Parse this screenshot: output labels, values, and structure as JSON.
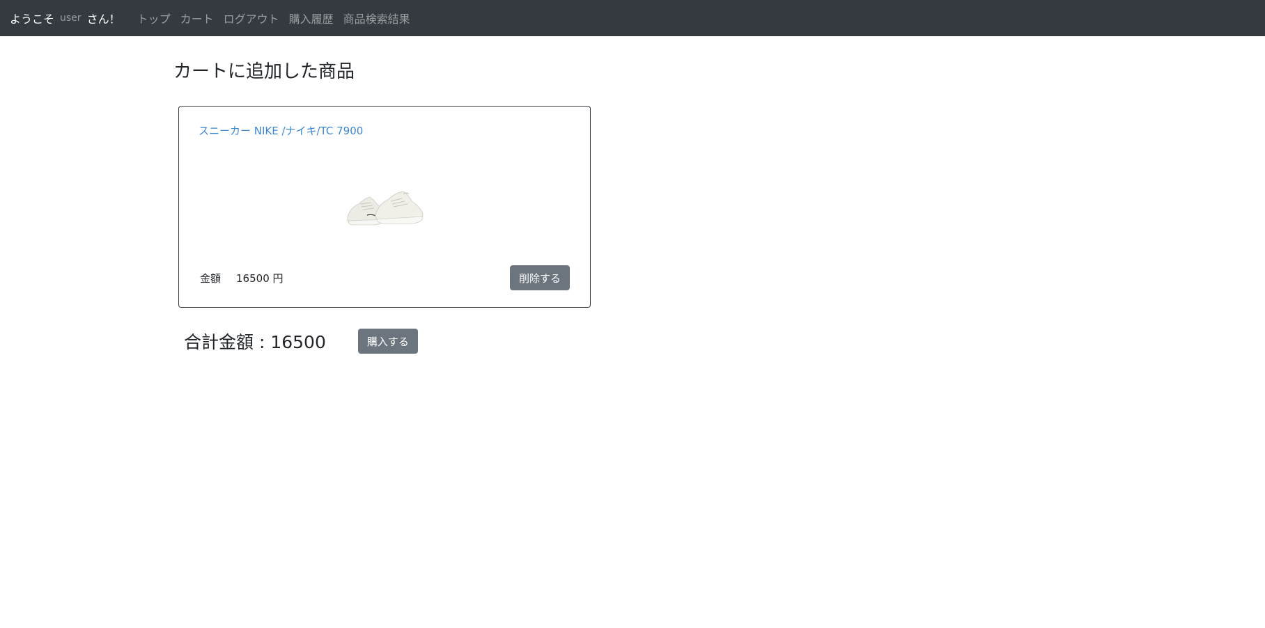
{
  "nav": {
    "welcome_prefix": "ようこそ",
    "username": "user",
    "welcome_suffix": "さん！",
    "links": [
      "トップ",
      "カート",
      "ログアウト",
      "購入履歴",
      "商品検索結果"
    ]
  },
  "page": {
    "title": "カートに追加した商品"
  },
  "cart_items": [
    {
      "name": "スニーカー NIKE /ナイキ/TC 7900",
      "image_icon": "sneaker-image",
      "price_label": "金額",
      "price_value": "16500 円",
      "delete_label": "削除する"
    }
  ],
  "summary": {
    "total_text": "合計金額 : 16500",
    "purchase_label": "購入する"
  },
  "colors": {
    "navbar_bg": "#343a40",
    "nav_link": "#9a9da0",
    "product_link": "#3b86d4",
    "button_bg": "#6c757d"
  }
}
